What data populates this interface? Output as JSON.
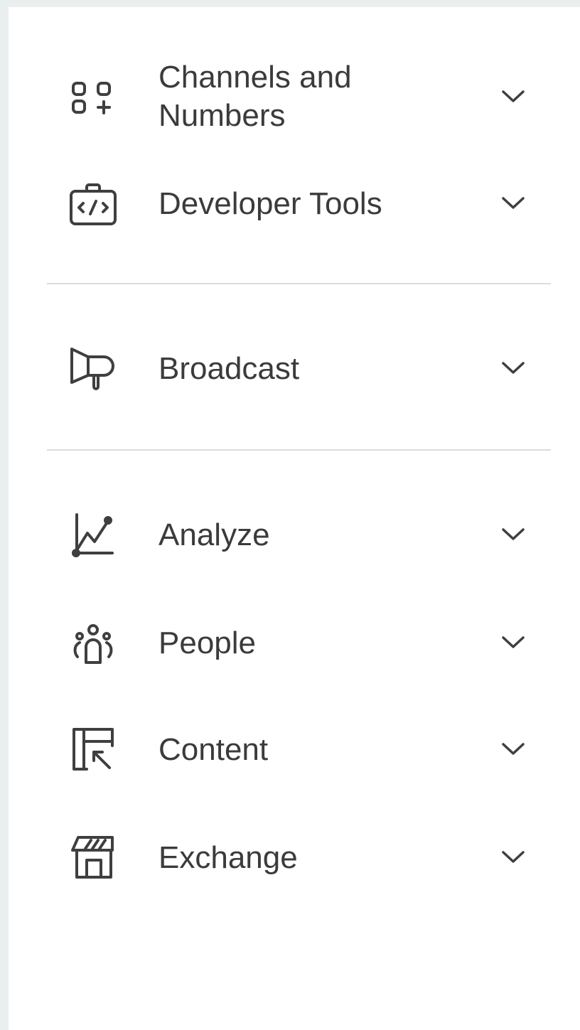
{
  "nav": {
    "channels_numbers": {
      "label": "Channels and\nNumbers",
      "icon": "apps-add-icon"
    },
    "developer_tools": {
      "label": "Developer Tools",
      "icon": "code-briefcase-icon"
    },
    "broadcast": {
      "label": "Broadcast",
      "icon": "megaphone-icon"
    },
    "analyze": {
      "label": "Analyze",
      "icon": "line-chart-icon"
    },
    "people": {
      "label": "People",
      "icon": "people-icon"
    },
    "content": {
      "label": "Content",
      "icon": "content-layout-icon"
    },
    "exchange": {
      "label": "Exchange",
      "icon": "storefront-icon"
    }
  },
  "colors": {
    "background": "#e9efee",
    "panel": "#ffffff",
    "text": "#3b3b3b",
    "icon": "#3f3f3f",
    "divider": "#dcdcdc"
  }
}
